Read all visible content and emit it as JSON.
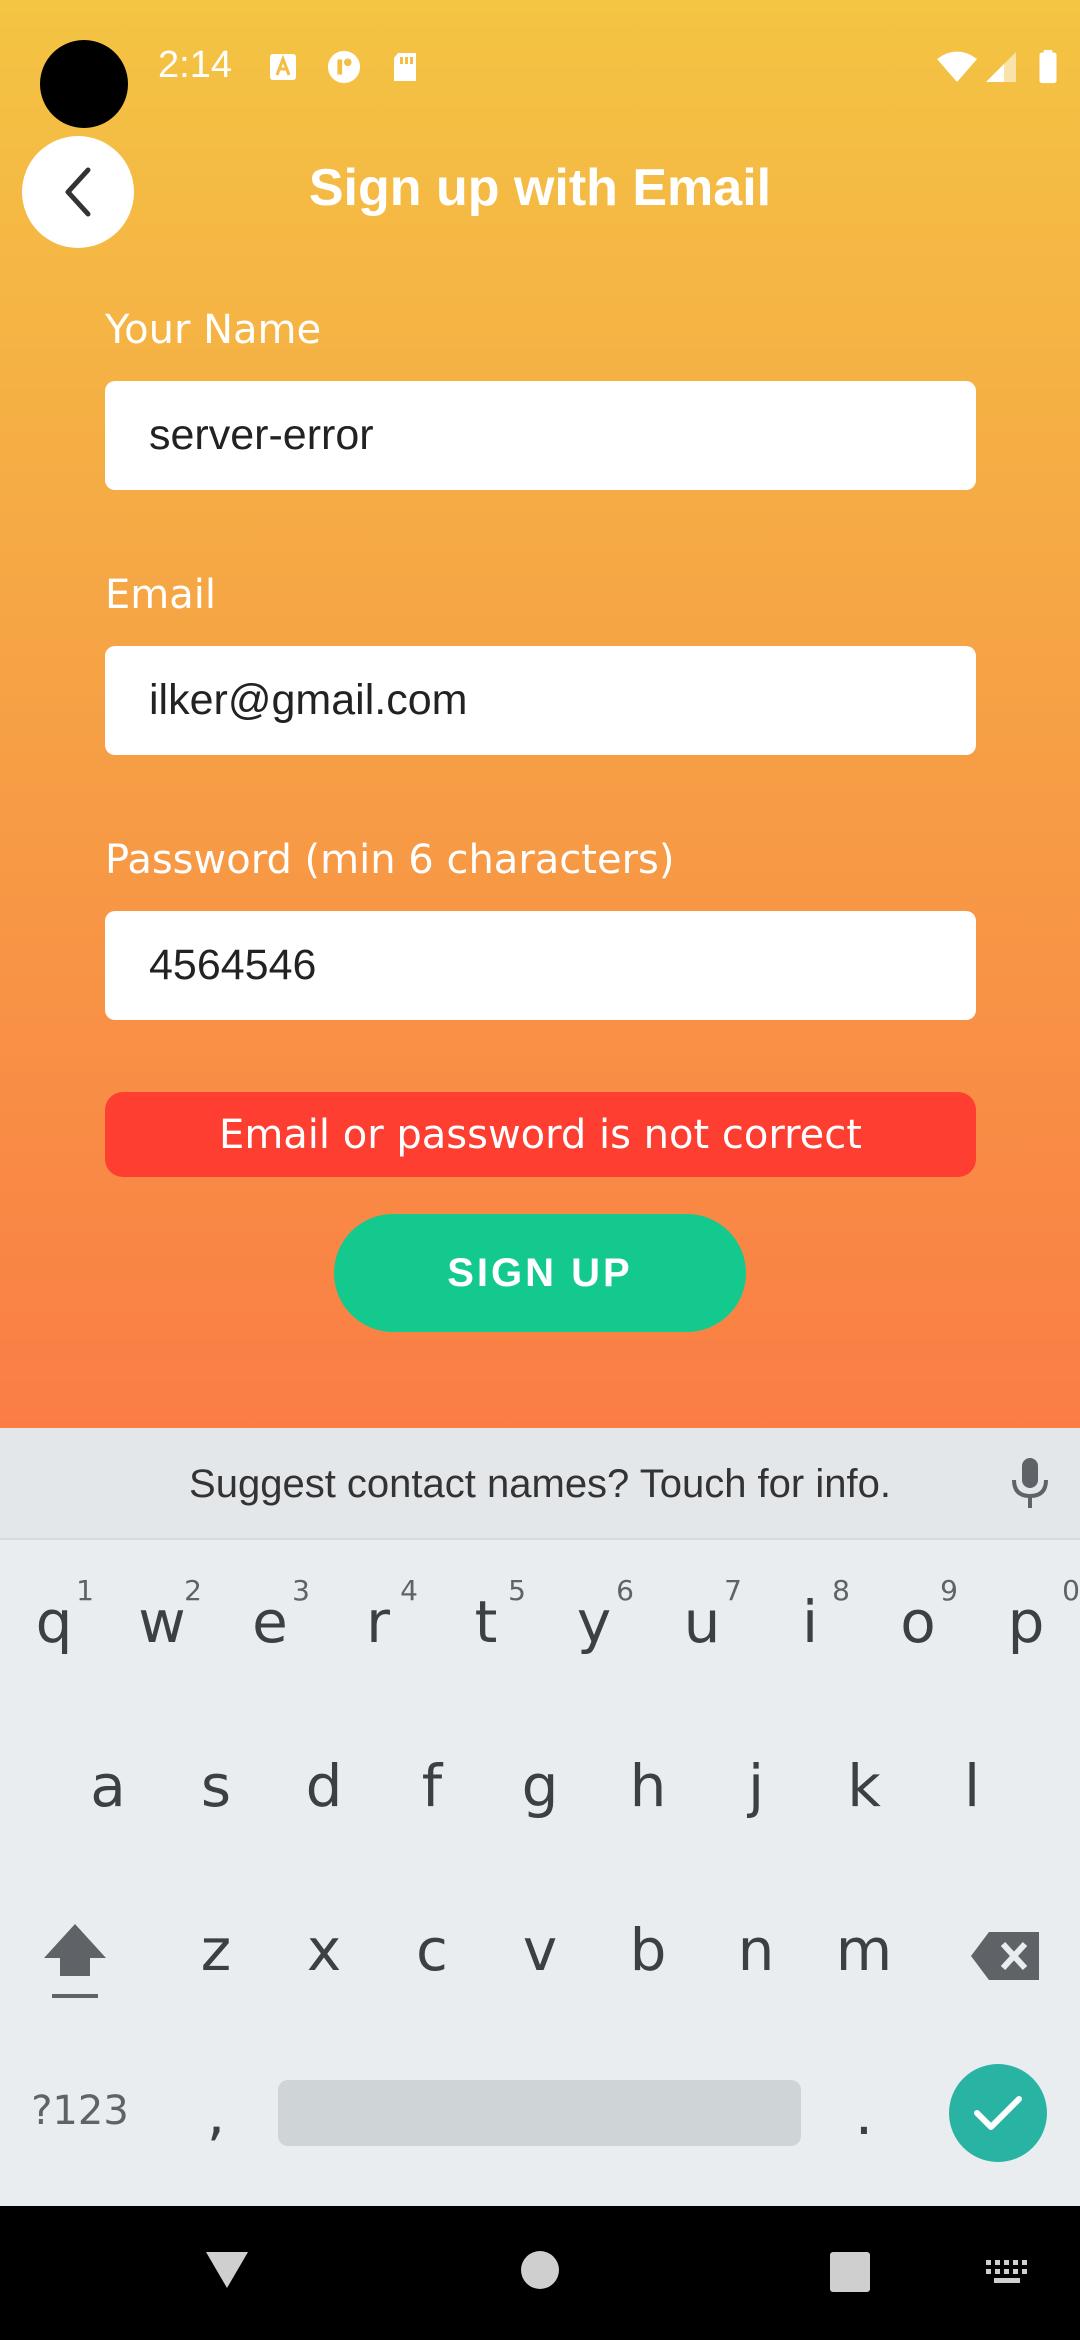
{
  "status_bar": {
    "time": "2:14"
  },
  "header": {
    "title": "Sign up with Email"
  },
  "form": {
    "name_label": "Your Name",
    "name_value": "server-error",
    "email_label": "Email",
    "email_value": "ilker@gmail.com",
    "password_label": "Password (min 6 characters)",
    "password_value": "4564546",
    "error_message": "Email or password is not correct",
    "signup_label": "SIGN UP"
  },
  "keyboard": {
    "suggestion": "Suggest contact names? Touch for info.",
    "row1": [
      "q",
      "w",
      "e",
      "r",
      "t",
      "y",
      "u",
      "i",
      "o",
      "p"
    ],
    "row1_hints": [
      "1",
      "2",
      "3",
      "4",
      "5",
      "6",
      "7",
      "8",
      "9",
      "0"
    ],
    "row2": [
      "a",
      "s",
      "d",
      "f",
      "g",
      "h",
      "j",
      "k",
      "l"
    ],
    "row3": [
      "z",
      "x",
      "c",
      "v",
      "b",
      "n",
      "m"
    ],
    "symbols_label": "?123",
    "comma": ",",
    "period": "."
  },
  "colors": {
    "gradient_top": "#f4c443",
    "gradient_bottom": "#fa7d45",
    "error": "#fe3e31",
    "primary_button": "#14c98e",
    "enter_key": "#28b3a3"
  }
}
